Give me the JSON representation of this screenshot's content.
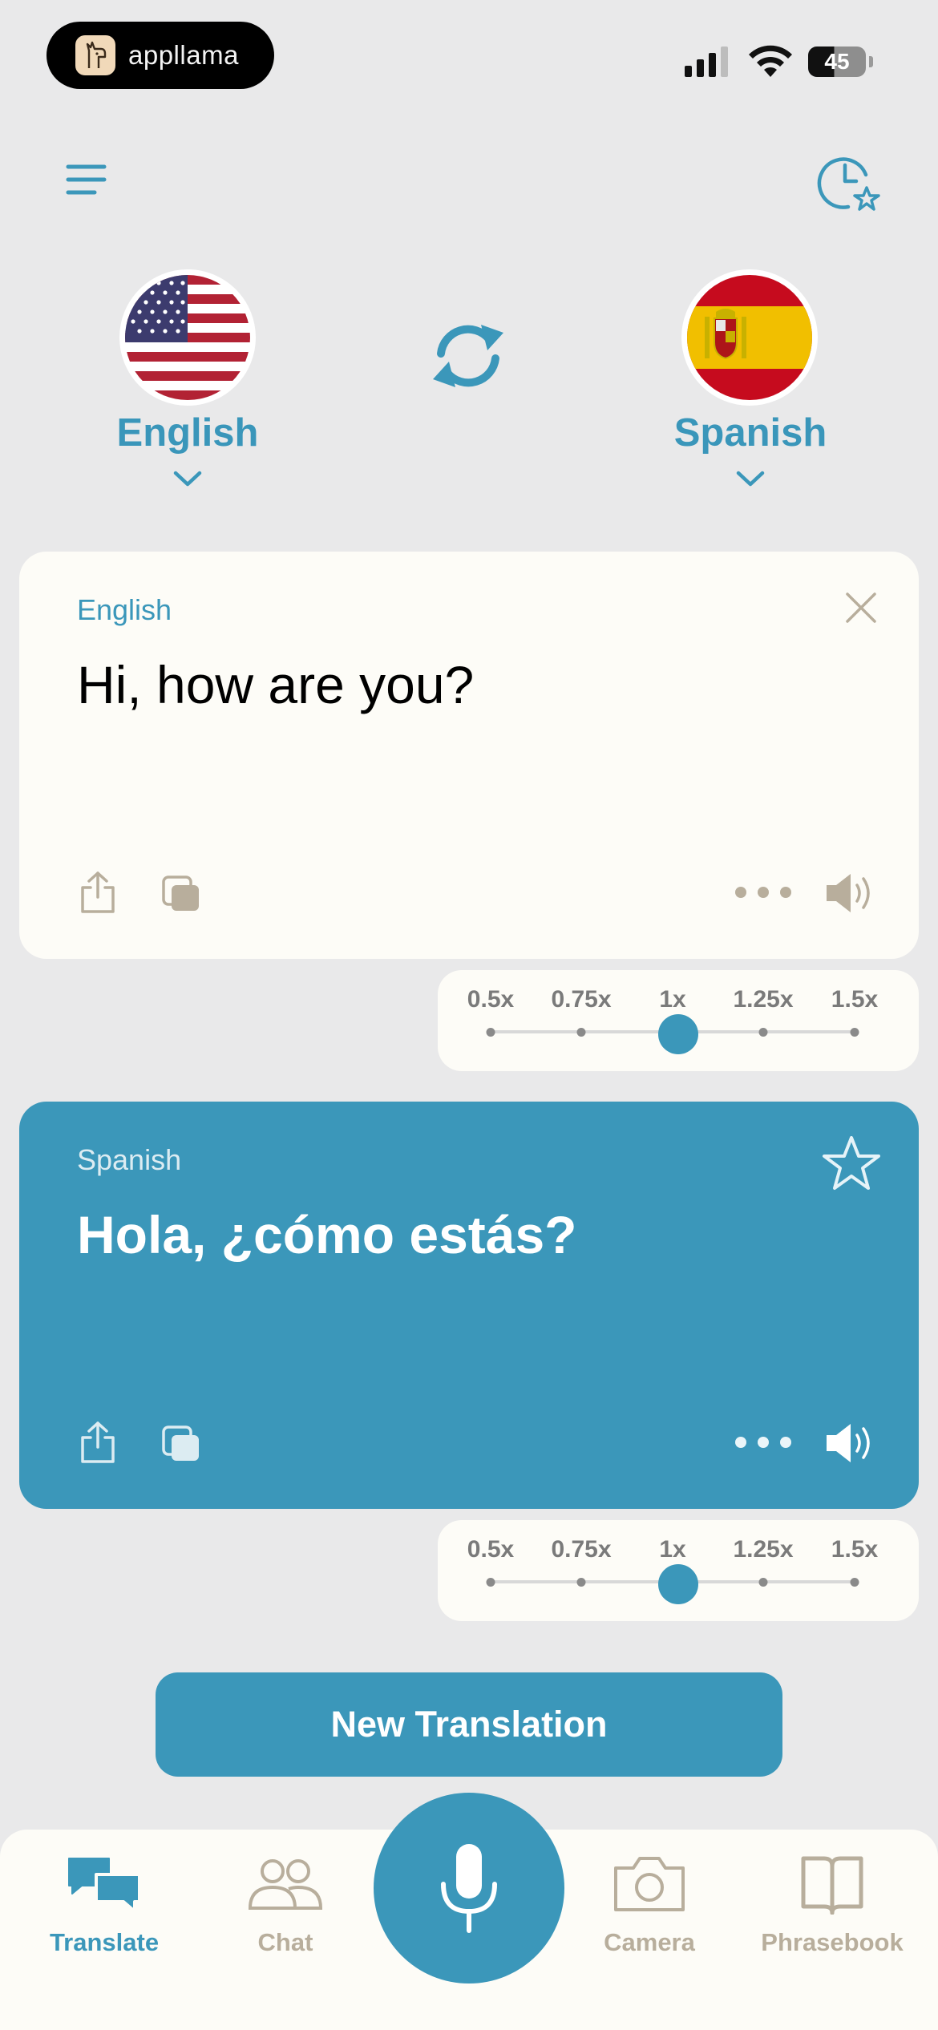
{
  "status_bar": {
    "brand": "appllama",
    "battery": "45"
  },
  "colors": {
    "accent": "#3b97ba",
    "card_bg": "#fdfcf7",
    "muted": "#b8ae9c",
    "background": "#e9e9ea"
  },
  "languages": {
    "source": {
      "name": "English",
      "flag": "us-flag"
    },
    "target": {
      "name": "Spanish",
      "flag": "spain-flag"
    }
  },
  "source_card": {
    "label": "English",
    "text": "Hi, how are you?"
  },
  "target_card": {
    "label": "Spanish",
    "text": "Hola, ¿cómo estás?"
  },
  "speed_options": [
    "0.5x",
    "0.75x",
    "1x",
    "1.25x",
    "1.5x"
  ],
  "source_speed": "1x",
  "target_speed": "1x",
  "new_translation_label": "New Translation",
  "tabs": [
    {
      "label": "Translate",
      "icon": "chat-bubbles-icon",
      "active": true
    },
    {
      "label": "Chat",
      "icon": "people-icon",
      "active": false
    },
    {
      "label": "Camera",
      "icon": "camera-icon",
      "active": false
    },
    {
      "label": "Phrasebook",
      "icon": "book-icon",
      "active": false
    }
  ]
}
